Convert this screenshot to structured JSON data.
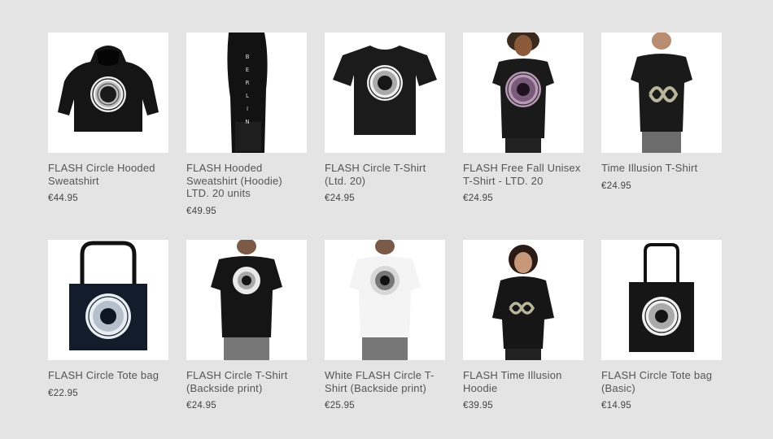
{
  "products": [
    {
      "title": "FLASH Circle Hooded Sweatshirt",
      "price": "€44.95",
      "image": "black-hoodie-circle-print"
    },
    {
      "title": "FLASH Hooded Sweatshirt (Hoodie) LTD. 20 units",
      "price": "€49.95",
      "image": "black-hoodie-sleeve-berlin",
      "sleeve_text": "BERLIN"
    },
    {
      "title": "FLASH Circle T-Shirt (Ltd. 20)",
      "price": "€24.95",
      "image": "black-tshirt-circle-print"
    },
    {
      "title": "FLASH Free Fall Unisex T-Shirt - LTD. 20",
      "price": "€24.95",
      "image": "model-black-tshirt-purple-circle"
    },
    {
      "title": "Time Illusion T-Shirt",
      "price": "€24.95",
      "image": "model-black-tshirt-coil-print"
    },
    {
      "title": "FLASH Circle Tote bag",
      "price": "€22.95",
      "image": "black-tote-bag-circle-print"
    },
    {
      "title": "FLASH Circle T-Shirt (Backside print)",
      "price": "€24.95",
      "image": "model-back-black-tshirt-circle"
    },
    {
      "title": "White FLASH Circle T-Shirt (Backside print)",
      "price": "€25.95",
      "image": "model-back-white-tshirt-circle"
    },
    {
      "title": "FLASH Time Illusion Hoodie",
      "price": "€39.95",
      "image": "model-black-hoodie-coil-print"
    },
    {
      "title": "FLASH Circle Tote bag (Basic)",
      "price": "€14.95",
      "image": "black-tote-bag-basic"
    }
  ]
}
